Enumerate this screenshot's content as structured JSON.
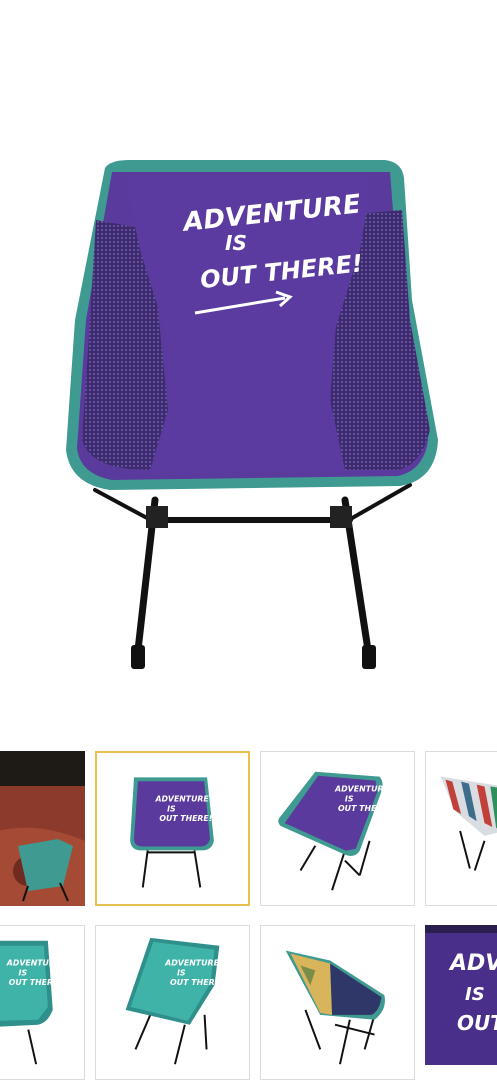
{
  "hero": {
    "alt": "Purple folding camp chair",
    "print_lines": [
      "ADVENTURE",
      "IS",
      "OUT THERE!"
    ],
    "colors": {
      "fabric": "#5a3a9c",
      "trim": "#3f9a92",
      "frame": "#111111"
    }
  },
  "gallery": {
    "selected_index": 1,
    "thumbnails": [
      {
        "name": "teal-chair-on-rug",
        "variant": "teal"
      },
      {
        "name": "purple-chair-front",
        "variant": "purple"
      },
      {
        "name": "purple-chair-angled",
        "variant": "purple"
      },
      {
        "name": "striped-chair",
        "variant": "striped"
      },
      {
        "name": "teal-chair-front",
        "variant": "teal"
      },
      {
        "name": "teal-chair-angled",
        "variant": "teal"
      },
      {
        "name": "camo-chair-side",
        "variant": "camo"
      },
      {
        "name": "purple-print-closeup",
        "variant": "purple"
      }
    ],
    "thumb_print": [
      "ADVENTURE",
      "IS",
      "OUT THERE!"
    ],
    "closeup_print": [
      "ADVENTU",
      "IS",
      "OUT"
    ]
  }
}
